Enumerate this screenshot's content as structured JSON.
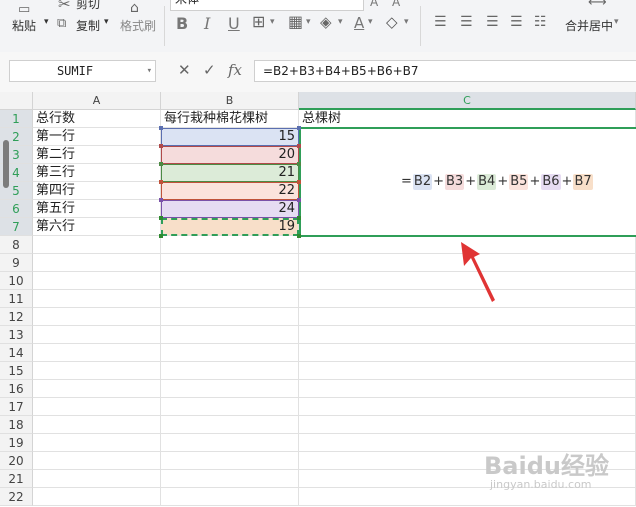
{
  "ribbon": {
    "cut_label": "剪切",
    "paste_label": "粘贴",
    "copy_label": "复制",
    "format_painter_label": "格式刷",
    "font_name": "宋体",
    "bold_label": "B",
    "italic_label": "I",
    "underline_label": "U",
    "merge_center_label": "合并居中"
  },
  "formula_bar": {
    "name_box": "SUMIF",
    "cancel_icon": "✕",
    "confirm_icon": "✓",
    "fx_label": "fx",
    "formula": "=B2+B3+B4+B5+B6+B7"
  },
  "columns": [
    "A",
    "B",
    "C"
  ],
  "rows": [
    "1",
    "2",
    "3",
    "4",
    "5",
    "6",
    "7",
    "8",
    "9",
    "10",
    "11",
    "12",
    "13",
    "14",
    "15",
    "16",
    "17",
    "18",
    "19",
    "20",
    "21",
    "22"
  ],
  "sheet": {
    "A1": "总行数",
    "B1": "每行栽种棉花棵树",
    "C1": "总棵树",
    "rows": [
      {
        "label": "第一行",
        "value": "15"
      },
      {
        "label": "第二行",
        "value": "20"
      },
      {
        "label": "第三行",
        "value": "21"
      },
      {
        "label": "第四行",
        "value": "22"
      },
      {
        "label": "第五行",
        "value": "24"
      },
      {
        "label": "第六行",
        "value": "19"
      }
    ]
  },
  "cell_formula": {
    "eq": "=",
    "refs": [
      "B2",
      "B3",
      "B4",
      "B5",
      "B6",
      "B7"
    ],
    "plus": "+"
  },
  "colors": {
    "ref_colors": [
      "#5b6fb0",
      "#b04a4a",
      "#4c8a44",
      "#c0533a",
      "#7a52a8",
      "#2f8a2f"
    ],
    "ref_fills": [
      "#dbe3f3",
      "#f5dcdc",
      "#dcebd8",
      "#fbe3dc",
      "#e6dcf2",
      "#f8dfc9"
    ],
    "active_border": "#2f9e58",
    "arrow": "#e03434"
  },
  "watermark": {
    "brand": "Baidu经验",
    "url": "jingyan.baidu.com"
  }
}
